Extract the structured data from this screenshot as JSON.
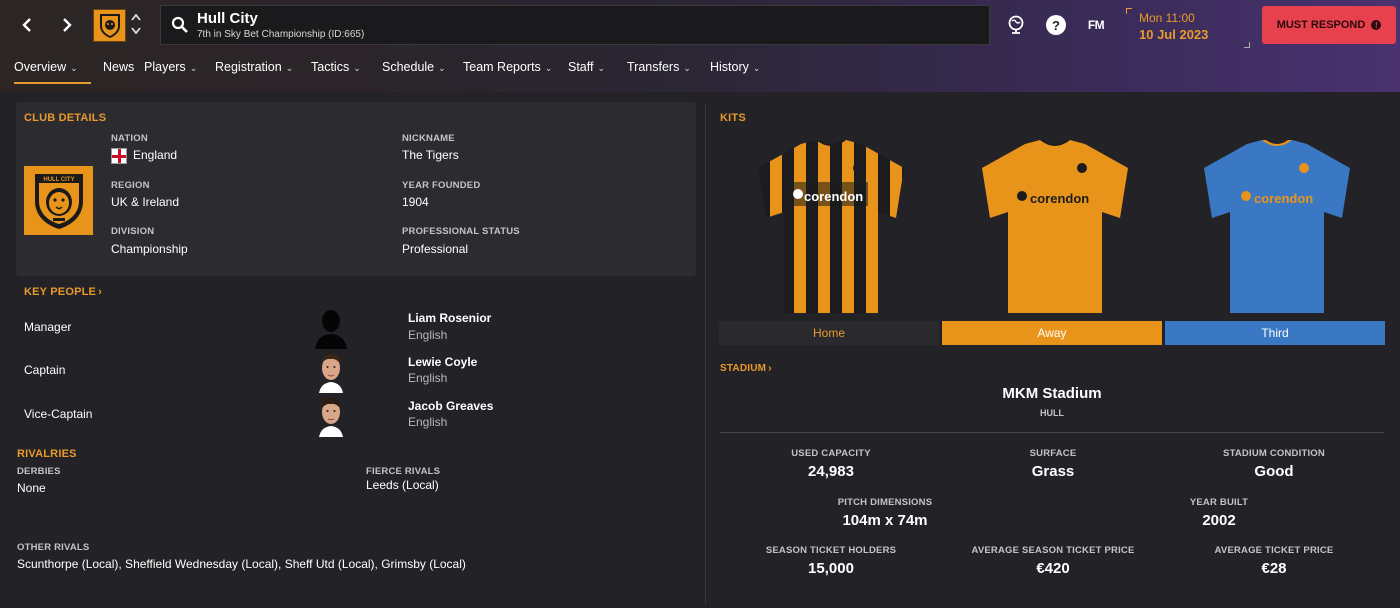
{
  "header": {
    "club_name": "Hull City",
    "club_subtitle": "7th in Sky Bet Championship (ID:665)",
    "date_day": "Mon 11:00",
    "date_date": "10 Jul 2023",
    "must_respond": "MUST RESPOND",
    "fm_logo": "FM",
    "help": "?"
  },
  "tabs": [
    {
      "label": "Overview"
    },
    {
      "label": "News"
    },
    {
      "label": "Players"
    },
    {
      "label": "Registration"
    },
    {
      "label": "Tactics"
    },
    {
      "label": "Schedule"
    },
    {
      "label": "Team Reports"
    },
    {
      "label": "Staff"
    },
    {
      "label": "Transfers"
    },
    {
      "label": "History"
    }
  ],
  "club_details": {
    "title": "CLUB DETAILS",
    "nation_label": "NATION",
    "nation": "England",
    "region_label": "REGION",
    "region": "UK & Ireland",
    "division_label": "DIVISION",
    "division": "Championship",
    "nickname_label": "NICKNAME",
    "nickname": "The Tigers",
    "founded_label": "YEAR FOUNDED",
    "founded": "1904",
    "status_label": "PROFESSIONAL STATUS",
    "status": "Professional"
  },
  "key_people": {
    "title": "KEY PEOPLE",
    "people": [
      {
        "role": "Manager",
        "name": "Liam Rosenior",
        "nationality": "English"
      },
      {
        "role": "Captain",
        "name": "Lewie Coyle",
        "nationality": "English"
      },
      {
        "role": "Vice-Captain",
        "name": "Jacob Greaves",
        "nationality": "English"
      }
    ]
  },
  "rivalries": {
    "title": "RIVALRIES",
    "derbies_label": "DERBIES",
    "derbies": "None",
    "fierce_label": "FIERCE RIVALS",
    "fierce": "Leeds (Local)",
    "other_label": "OTHER RIVALS",
    "other": "Scunthorpe (Local), Sheffield Wednesday (Local), Sheff Utd (Local), Grimsby (Local)"
  },
  "kits": {
    "title": "KITS",
    "sponsor": "corendon",
    "tabs": [
      {
        "label": "Home",
        "color": "#2a2a2e",
        "text_color": "#e89a2a"
      },
      {
        "label": "Away",
        "color": "#e8941a",
        "text_color": "#ffffff"
      },
      {
        "label": "Third",
        "color": "#3b78c4",
        "text_color": "#ffffff"
      }
    ]
  },
  "stadium": {
    "title": "STADIUM",
    "name": "MKM Stadium",
    "city": "HULL",
    "stats": {
      "capacity_label": "USED CAPACITY",
      "capacity": "24,983",
      "surface_label": "SURFACE",
      "surface": "Grass",
      "condition_label": "STADIUM CONDITION",
      "condition": "Good",
      "pitch_label": "PITCH DIMENSIONS",
      "pitch": "104m x 74m",
      "built_label": "YEAR BUILT",
      "built": "2002",
      "holders_label": "SEASON TICKET HOLDERS",
      "holders": "15,000",
      "avg_season_label": "AVERAGE SEASON TICKET PRICE",
      "avg_season": "€420",
      "avg_ticket_label": "AVERAGE TICKET PRICE",
      "avg_ticket": "€28"
    }
  },
  "colors": {
    "accent": "#e89a2a",
    "alert": "#e8414e",
    "panel": "#2c2b30",
    "background": "#232226"
  }
}
